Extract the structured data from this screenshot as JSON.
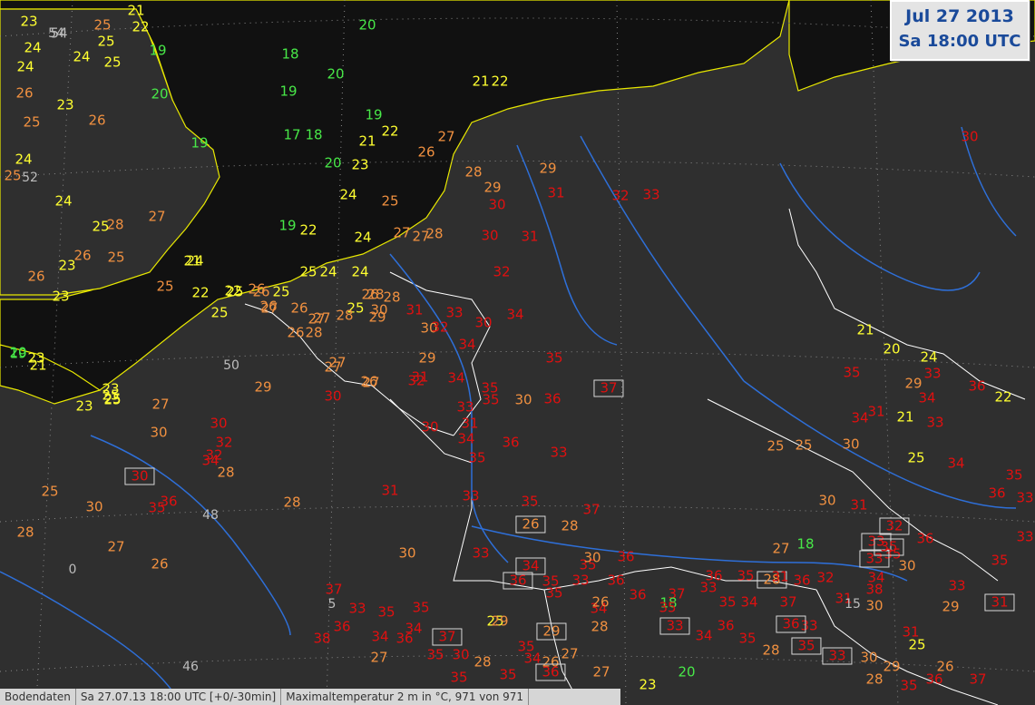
{
  "header": {
    "date": "Jul 27 2013",
    "time": "Sa 18:00 UTC"
  },
  "status": {
    "source": "Bodendaten",
    "timestamp": "Sa 27.07.13 18:00 UTC [+0/-30min]",
    "parameter": "Maximaltemperatur 2 m in °C, 971 von 971"
  },
  "grid_labels": [
    "54",
    "52",
    "50",
    "48",
    "46",
    "0",
    "5",
    "15"
  ],
  "colors": {
    "background": "#2f2f2f",
    "sea": "#111111",
    "coast": "#e8e800",
    "border": "#ffffff",
    "river": "#2e6fd8",
    "t_low": "#48e848",
    "t_mid": "#ffff30",
    "t_warm": "#f09040",
    "t_hot": "#e01010"
  },
  "stations": [
    {
      "v": "23",
      "c": "y"
    },
    {
      "v": "25",
      "c": "o"
    },
    {
      "v": "21",
      "c": "y"
    },
    {
      "v": "22",
      "c": "y"
    },
    {
      "v": "19",
      "c": "g"
    },
    {
      "v": "24",
      "c": "y"
    },
    {
      "v": "54",
      "c": "s"
    },
    {
      "v": "25",
      "c": "y"
    },
    {
      "v": "24",
      "c": "y"
    },
    {
      "v": "25",
      "c": "y"
    },
    {
      "v": "20",
      "c": "g"
    },
    {
      "v": "18",
      "c": "g"
    },
    {
      "v": "20",
      "c": "g"
    },
    {
      "v": "19",
      "c": "g"
    },
    {
      "v": "20",
      "c": "g"
    },
    {
      "v": "21",
      "c": "y"
    },
    {
      "v": "22",
      "c": "y"
    },
    {
      "v": "24",
      "c": "y"
    },
    {
      "v": "26",
      "c": "o"
    },
    {
      "v": "23",
      "c": "y"
    },
    {
      "v": "25",
      "c": "o"
    },
    {
      "v": "26",
      "c": "o"
    },
    {
      "v": "19",
      "c": "g"
    },
    {
      "v": "17",
      "c": "g"
    },
    {
      "v": "18",
      "c": "g"
    },
    {
      "v": "19",
      "c": "g"
    },
    {
      "v": "21",
      "c": "y"
    },
    {
      "v": "22",
      "c": "y"
    },
    {
      "v": "24",
      "c": "y"
    },
    {
      "v": "25",
      "c": "o"
    },
    {
      "v": "24",
      "c": "y"
    },
    {
      "v": "28",
      "c": "o"
    },
    {
      "v": "27",
      "c": "o"
    },
    {
      "v": "25",
      "c": "y"
    },
    {
      "v": "26",
      "c": "o"
    },
    {
      "v": "25",
      "c": "o"
    },
    {
      "v": "21",
      "c": "y"
    },
    {
      "v": "26",
      "c": "o"
    },
    {
      "v": "23",
      "c": "y"
    },
    {
      "v": "19",
      "c": "g"
    },
    {
      "v": "20",
      "c": "g"
    },
    {
      "v": "23",
      "c": "y"
    },
    {
      "v": "26",
      "c": "o"
    },
    {
      "v": "27",
      "c": "o"
    },
    {
      "v": "24",
      "c": "y"
    },
    {
      "v": "25",
      "c": "o"
    },
    {
      "v": "27",
      "c": "o"
    },
    {
      "v": "24",
      "c": "y"
    },
    {
      "v": "28",
      "c": "o"
    },
    {
      "v": "29",
      "c": "o"
    },
    {
      "v": "30",
      "c": "r"
    },
    {
      "v": "29",
      "c": "o"
    },
    {
      "v": "31",
      "c": "r"
    },
    {
      "v": "32",
      "c": "r"
    },
    {
      "v": "33",
      "c": "r"
    },
    {
      "v": "30",
      "c": "r"
    },
    {
      "v": "25",
      "c": "o"
    },
    {
      "v": "23",
      "c": "y"
    },
    {
      "v": "26",
      "c": "o"
    },
    {
      "v": "27",
      "c": "o"
    },
    {
      "v": "25",
      "c": "y"
    },
    {
      "v": "23",
      "c": "y"
    },
    {
      "v": "26",
      "c": "o"
    },
    {
      "v": "27",
      "c": "o"
    },
    {
      "v": "28",
      "c": "o"
    },
    {
      "v": "24",
      "c": "y"
    },
    {
      "v": "19",
      "c": "g"
    },
    {
      "v": "22",
      "c": "y"
    },
    {
      "v": "25",
      "c": "y"
    },
    {
      "v": "24",
      "c": "y"
    },
    {
      "v": "27",
      "c": "o"
    },
    {
      "v": "28",
      "c": "o"
    },
    {
      "v": "30",
      "c": "r"
    },
    {
      "v": "32",
      "c": "r"
    },
    {
      "v": "31",
      "c": "r"
    },
    {
      "v": "25",
      "c": "y"
    },
    {
      "v": "22",
      "c": "y"
    },
    {
      "v": "24",
      "c": "y"
    },
    {
      "v": "26",
      "c": "o"
    },
    {
      "v": "25",
      "c": "y"
    },
    {
      "v": "26",
      "c": "o"
    },
    {
      "v": "28",
      "c": "o"
    },
    {
      "v": "30",
      "c": "o"
    },
    {
      "v": "29",
      "c": "o"
    },
    {
      "v": "32",
      "c": "r"
    },
    {
      "v": "33",
      "c": "r"
    },
    {
      "v": "30",
      "c": "r"
    },
    {
      "v": "34",
      "c": "r"
    },
    {
      "v": "22",
      "c": "y"
    },
    {
      "v": "25",
      "c": "y"
    },
    {
      "v": "26",
      "c": "o"
    },
    {
      "v": "27",
      "c": "o"
    },
    {
      "v": "28",
      "c": "o"
    },
    {
      "v": "25",
      "c": "y"
    },
    {
      "v": "23",
      "c": "y"
    },
    {
      "v": "25",
      "c": "y"
    },
    {
      "v": "27",
      "c": "o"
    },
    {
      "v": "26",
      "c": "o"
    },
    {
      "v": "28",
      "c": "o"
    },
    {
      "v": "29",
      "c": "o"
    },
    {
      "v": "30",
      "c": "o"
    },
    {
      "v": "31",
      "c": "r"
    },
    {
      "v": "32",
      "c": "r"
    },
    {
      "v": "34",
      "c": "r"
    },
    {
      "v": "35",
      "c": "r"
    },
    {
      "v": "20",
      "c": "g"
    },
    {
      "v": "21",
      "c": "y"
    },
    {
      "v": "27",
      "c": "o"
    },
    {
      "v": "26",
      "c": "o"
    },
    {
      "v": "29",
      "c": "o"
    },
    {
      "v": "27",
      "c": "o"
    },
    {
      "v": "30",
      "c": "r"
    },
    {
      "v": "31",
      "c": "r"
    },
    {
      "v": "34",
      "c": "r"
    },
    {
      "v": "35",
      "c": "r"
    },
    {
      "v": "36",
      "c": "r"
    },
    {
      "v": "37",
      "c": "r"
    },
    {
      "v": "23",
      "c": "y"
    },
    {
      "v": "25",
      "c": "y"
    },
    {
      "v": "27",
      "c": "o"
    },
    {
      "v": "30",
      "c": "o"
    },
    {
      "v": "30",
      "c": "r"
    },
    {
      "v": "32",
      "c": "r"
    },
    {
      "v": "33",
      "c": "r"
    },
    {
      "v": "35",
      "c": "r"
    },
    {
      "v": "30",
      "c": "o"
    },
    {
      "v": "31",
      "c": "r"
    },
    {
      "v": "32",
      "c": "r"
    },
    {
      "v": "34",
      "c": "r"
    },
    {
      "v": "28",
      "c": "o"
    },
    {
      "v": "30",
      "c": "r"
    },
    {
      "v": "34",
      "c": "r"
    },
    {
      "v": "35",
      "c": "r"
    },
    {
      "v": "36",
      "c": "r"
    },
    {
      "v": "33",
      "c": "r"
    },
    {
      "v": "25",
      "c": "o"
    },
    {
      "v": "30",
      "c": "o"
    },
    {
      "v": "30",
      "c": "r"
    },
    {
      "v": "35",
      "c": "r"
    },
    {
      "v": "36",
      "c": "r"
    },
    {
      "v": "28",
      "c": "o"
    },
    {
      "v": "31",
      "c": "r"
    },
    {
      "v": "33",
      "c": "r"
    },
    {
      "v": "35",
      "c": "r"
    },
    {
      "v": "37",
      "c": "r"
    },
    {
      "v": "28",
      "c": "o"
    },
    {
      "v": "27",
      "c": "o"
    },
    {
      "v": "26",
      "c": "o"
    },
    {
      "v": "30",
      "c": "o"
    },
    {
      "v": "33",
      "c": "r"
    },
    {
      "v": "34",
      "c": "r"
    },
    {
      "v": "35",
      "c": "r"
    },
    {
      "v": "36",
      "c": "r"
    },
    {
      "v": "35",
      "c": "r"
    },
    {
      "v": "34",
      "c": "r"
    },
    {
      "v": "36",
      "c": "r"
    },
    {
      "v": "37",
      "c": "r"
    },
    {
      "v": "33",
      "c": "r"
    },
    {
      "v": "35",
      "c": "r"
    },
    {
      "v": "34",
      "c": "r"
    },
    {
      "v": "37",
      "c": "r"
    },
    {
      "v": "36",
      "c": "r"
    },
    {
      "v": "33",
      "c": "r"
    },
    {
      "v": "31",
      "c": "r"
    },
    {
      "v": "30",
      "c": "o"
    },
    {
      "v": "29",
      "c": "o"
    },
    {
      "v": "31",
      "c": "r"
    },
    {
      "v": "25",
      "c": "o"
    },
    {
      "v": "25",
      "c": "o"
    },
    {
      "v": "30",
      "c": "o"
    },
    {
      "v": "31",
      "c": "r"
    },
    {
      "v": "34",
      "c": "r"
    },
    {
      "v": "33",
      "c": "r"
    },
    {
      "v": "35",
      "c": "r"
    },
    {
      "v": "34",
      "c": "r"
    },
    {
      "v": "33",
      "c": "r"
    },
    {
      "v": "36",
      "c": "r"
    },
    {
      "v": "29",
      "c": "o"
    },
    {
      "v": "33",
      "c": "r"
    },
    {
      "v": "35",
      "c": "r"
    },
    {
      "v": "36",
      "c": "r"
    },
    {
      "v": "33",
      "c": "r"
    },
    {
      "v": "35",
      "c": "r"
    },
    {
      "v": "33",
      "c": "r"
    },
    {
      "v": "36",
      "c": "r"
    },
    {
      "v": "35",
      "c": "r"
    },
    {
      "v": "33",
      "c": "r"
    },
    {
      "v": "34",
      "c": "r"
    },
    {
      "v": "25",
      "c": "y"
    },
    {
      "v": "21",
      "c": "y"
    },
    {
      "v": "22",
      "c": "y"
    },
    {
      "v": "24",
      "c": "y"
    },
    {
      "v": "20",
      "c": "y"
    },
    {
      "v": "21",
      "c": "y"
    },
    {
      "v": "18",
      "c": "g"
    },
    {
      "v": "18",
      "c": "g"
    },
    {
      "v": "20",
      "c": "g"
    },
    {
      "v": "23",
      "c": "y"
    },
    {
      "v": "25",
      "c": "y"
    },
    {
      "v": "29",
      "c": "o"
    },
    {
      "v": "29",
      "c": "o"
    },
    {
      "v": "27",
      "c": "o"
    },
    {
      "v": "28",
      "c": "o"
    },
    {
      "v": "26",
      "c": "o"
    },
    {
      "v": "27",
      "c": "o"
    },
    {
      "v": "28",
      "c": "o"
    },
    {
      "v": "26",
      "c": "o"
    },
    {
      "v": "28",
      "c": "o"
    },
    {
      "v": "30",
      "c": "o"
    },
    {
      "v": "26",
      "c": "o"
    },
    {
      "v": "28",
      "c": "o"
    },
    {
      "v": "27",
      "c": "o"
    },
    {
      "v": "35",
      "c": "r"
    },
    {
      "v": "34",
      "c": "r"
    },
    {
      "v": "37",
      "c": "r"
    },
    {
      "v": "35",
      "c": "r"
    },
    {
      "v": "30",
      "c": "r"
    },
    {
      "v": "34",
      "c": "r"
    },
    {
      "v": "36",
      "c": "r"
    },
    {
      "v": "35",
      "c": "r"
    },
    {
      "v": "37",
      "c": "r"
    },
    {
      "v": "38",
      "c": "r"
    },
    {
      "v": "36",
      "c": "r"
    },
    {
      "v": "35",
      "c": "r"
    },
    {
      "v": "33",
      "c": "r"
    },
    {
      "v": "34",
      "c": "r"
    },
    {
      "v": "36",
      "c": "r"
    },
    {
      "v": "35",
      "c": "r"
    },
    {
      "v": "27",
      "c": "o"
    },
    {
      "v": "35",
      "c": "r"
    },
    {
      "v": "36",
      "c": "r"
    },
    {
      "v": "35",
      "c": "r"
    },
    {
      "v": "33",
      "c": "r"
    },
    {
      "v": "36",
      "c": "r"
    },
    {
      "v": "35",
      "c": "r"
    },
    {
      "v": "36",
      "c": "r"
    },
    {
      "v": "35",
      "c": "r"
    },
    {
      "v": "31",
      "c": "r"
    },
    {
      "v": "32",
      "c": "r"
    },
    {
      "v": "33",
      "c": "r"
    },
    {
      "v": "34",
      "c": "r"
    },
    {
      "v": "36",
      "c": "r"
    },
    {
      "v": "35",
      "c": "r"
    },
    {
      "v": "28",
      "c": "o"
    },
    {
      "v": "30",
      "c": "o"
    },
    {
      "v": "29",
      "c": "o"
    },
    {
      "v": "25",
      "c": "y"
    },
    {
      "v": "26",
      "c": "o"
    },
    {
      "v": "28",
      "c": "o"
    },
    {
      "v": "35",
      "c": "r"
    },
    {
      "v": "36",
      "c": "r"
    },
    {
      "v": "37",
      "c": "r"
    },
    {
      "v": "31",
      "c": "r"
    },
    {
      "v": "33",
      "c": "r"
    },
    {
      "v": "35",
      "c": "r"
    },
    {
      "v": "36",
      "c": "r"
    },
    {
      "v": "38",
      "c": "r"
    },
    {
      "v": "34",
      "c": "r"
    },
    {
      "v": "33",
      "c": "r"
    },
    {
      "v": "35",
      "c": "r"
    },
    {
      "v": "30",
      "c": "o"
    },
    {
      "v": "30",
      "c": "o"
    },
    {
      "v": "31",
      "c": "r"
    },
    {
      "v": "32",
      "c": "r"
    }
  ]
}
